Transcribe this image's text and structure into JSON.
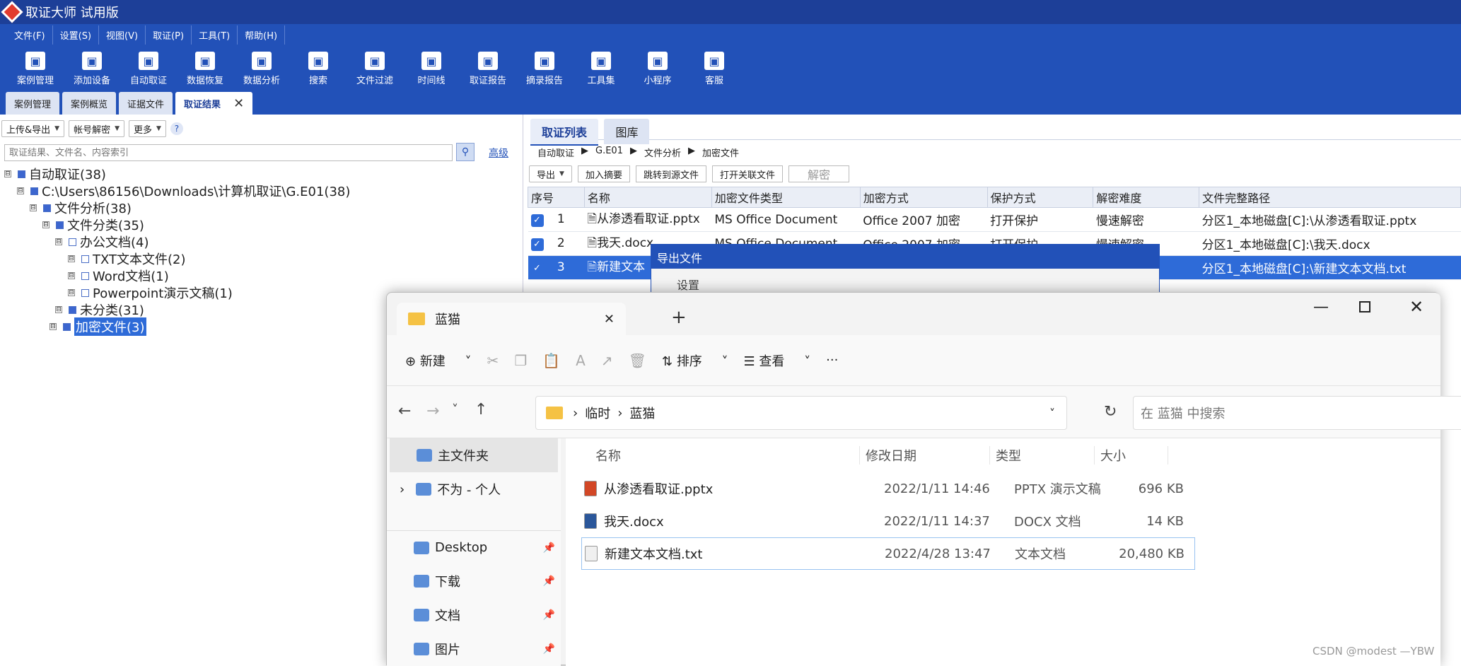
{
  "app": {
    "title": "取证大师 试用版"
  },
  "menu": [
    "文件(F)",
    "设置(S)",
    "视图(V)",
    "取证(P)",
    "工具(T)",
    "帮助(H)"
  ],
  "toolbar": [
    {
      "label": "案例管理",
      "icon": "case-icon"
    },
    {
      "label": "添加设备",
      "icon": "add-device-icon"
    },
    {
      "label": "自动取证",
      "icon": "auto-icon"
    },
    {
      "label": "数据恢复",
      "icon": "recover-icon"
    },
    {
      "label": "数据分析",
      "icon": "analysis-icon"
    },
    {
      "label": "搜索",
      "icon": "search-icon"
    },
    {
      "label": "文件过滤",
      "icon": "filter-icon"
    },
    {
      "label": "时间线",
      "icon": "timeline-icon"
    },
    {
      "label": "取证报告",
      "icon": "report-icon"
    },
    {
      "label": "摘录报告",
      "icon": "excerpt-icon"
    },
    {
      "label": "工具集",
      "icon": "tools-icon"
    },
    {
      "label": "小程序",
      "icon": "miniapp-icon"
    },
    {
      "label": "客服",
      "icon": "support-icon"
    }
  ],
  "tabs": [
    "案例管理",
    "案例概览",
    "证据文件",
    "取证结果"
  ],
  "left": {
    "dropdowns": [
      "上传&导出",
      "帐号解密",
      "更多"
    ],
    "help": "?",
    "search_placeholder": "取证结果、文件名、内容索引",
    "advanced": "高级",
    "tree": [
      "自动取证(38)",
      "C:\\Users\\86156\\Downloads\\计算机取证\\G.E01(38)",
      "文件分析(38)",
      "文件分类(35)",
      "办公文档(4)",
      "TXT文本文件(2)",
      "Word文档(1)",
      "Powerpoint演示文稿(1)",
      "未分类(31)",
      "加密文件(3)"
    ]
  },
  "right": {
    "tabs": [
      "取证列表",
      "图库"
    ],
    "breadcrumb": [
      "自动取证",
      "G.E01",
      "文件分析",
      "加密文件"
    ],
    "buttons": [
      "导出",
      "加入摘要",
      "跳转到源文件",
      "打开关联文件",
      "解密"
    ],
    "columns": [
      "序号",
      "名称",
      "加密文件类型",
      "加密方式",
      "保护方式",
      "解密难度",
      "文件完整路径"
    ],
    "rows": [
      [
        "1",
        "从渗透看取证.pptx",
        "MS Office Document",
        "Office 2007 加密",
        "打开保护",
        "慢速解密",
        "分区1_本地磁盘[C]:\\从渗透看取证.pptx"
      ],
      [
        "2",
        "我天.docx",
        "MS Office Document",
        "Office 2007 加密",
        "打开保护",
        "慢速解密",
        "分区1_本地磁盘[C]:\\我天.docx"
      ],
      [
        "3",
        "新建文本",
        "",
        "",
        "",
        "",
        "分区1_本地磁盘[C]:\\新建文本文档.txt"
      ]
    ]
  },
  "export_dialog": {
    "title": "导出文件",
    "section": "设置"
  },
  "explorer": {
    "tab": "蓝猫",
    "plus": "+",
    "cmd": {
      "new": "新建",
      "sort": "排序",
      "view": "查看",
      "more": "···"
    },
    "path": [
      "临时",
      "蓝猫"
    ],
    "search_placeholder": "在 蓝猫 中搜索",
    "nav": [
      {
        "label": "主文件夹",
        "icon": "home-icon"
      },
      {
        "label": "不为 - 个人",
        "icon": "onedrive-icon"
      },
      {
        "label": "Desktop",
        "icon": "desktop-icon"
      },
      {
        "label": "下载",
        "icon": "download-icon"
      },
      {
        "label": "文档",
        "icon": "document-icon"
      },
      {
        "label": "图片",
        "icon": "picture-icon"
      }
    ],
    "columns": [
      "名称",
      "修改日期",
      "类型",
      "大小"
    ],
    "files": [
      {
        "name": "从渗透看取证.pptx",
        "date": "2022/1/11 14:46",
        "type": "PPTX 演示文稿",
        "size": "696 KB",
        "icon": "pptx-icon"
      },
      {
        "name": "我天.docx",
        "date": "2022/1/11 14:37",
        "type": "DOCX 文档",
        "size": "14 KB",
        "icon": "docx-icon"
      },
      {
        "name": "新建文本文档.txt",
        "date": "2022/4/28 13:47",
        "type": "文本文档",
        "size": "20,480 KB",
        "icon": "txt-icon"
      }
    ]
  },
  "watermark": "CSDN @modest —YBW"
}
